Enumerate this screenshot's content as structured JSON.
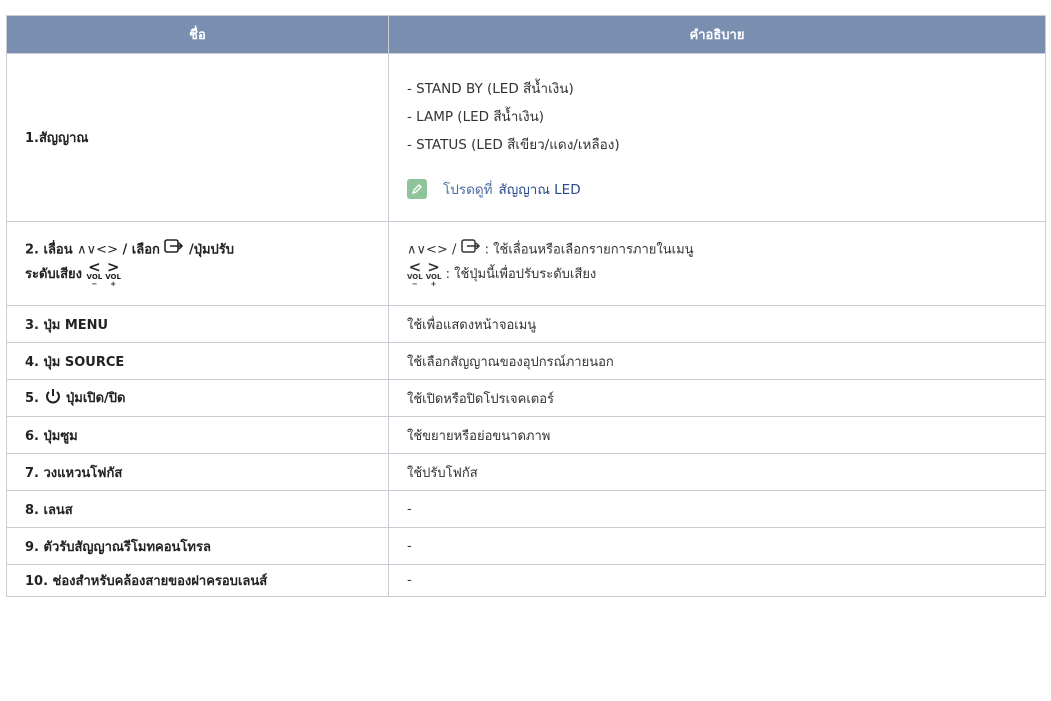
{
  "table": {
    "header": {
      "col_name": "ชื่อ",
      "col_desc": "คำอธิบาย"
    },
    "rows": [
      {
        "name": "1.สัญญาณ",
        "desc_lines": [
          "- STAND BY (LED สีน้ำเงิน)",
          "- LAMP (LED สีน้ำเงิน)",
          "- STATUS (LED สีเขียว/แดง/เหลือง)"
        ],
        "note_prefix": "โปรดดูที่",
        "note_link": "สัญญาณ LED",
        "note_icon": "pencil-note-icon"
      },
      {
        "name_part1": "2. เลื่อน",
        "name_arrows": "∧∨<>",
        "name_part2": "/ เลือก",
        "name_part3": "/ปุ่มปรับ",
        "name_part4": "ระดับเสียง",
        "vol_label": "VOL",
        "vol_minus": "−",
        "vol_plus": "+",
        "desc_line1_arrows": "∧∨<>",
        "desc_line1_text": ": ใช้เลื่อนหรือเลือกรายการภายในเมนู",
        "desc_line2_text": ": ใช้ปุ่มนี้เพื่อปรับระดับเสียง",
        "desc_line1_sep": "/"
      },
      {
        "name": "3. ปุ่ม MENU",
        "desc": "ใช้เพื่อแสดงหน้าจอเมนู"
      },
      {
        "name": "4. ปุ่ม SOURCE",
        "desc": "ใช้เลือกสัญญาณของอุปกรณ์ภายนอก"
      },
      {
        "name_prefix": "5.",
        "name": "ปุ่มเปิด/ปิด",
        "desc": "ใช้เปิดหรือปิดโปรเจคเตอร์"
      },
      {
        "name": "6. ปุ่มซูม",
        "desc": "ใช้ขยายหรือย่อขนาดภาพ"
      },
      {
        "name": "7. วงแหวนโฟกัส",
        "desc": "ใช้ปรับโฟกัส"
      },
      {
        "name": "8. เลนส",
        "desc": "-"
      },
      {
        "name": "9. ตัวรับสัญญาณรีโมทคอนโทรล",
        "desc": "-"
      },
      {
        "name": "10. ช่องสำหรับคล้องสายของฝาครอบเลนส์",
        "desc": "-"
      }
    ]
  },
  "colors": {
    "header_bg": "#7a8fb0",
    "header_text": "#ffffff",
    "border": "#c9cdd3",
    "note_icon_bg": "#8fc49a",
    "link": "#2a4a8c"
  }
}
